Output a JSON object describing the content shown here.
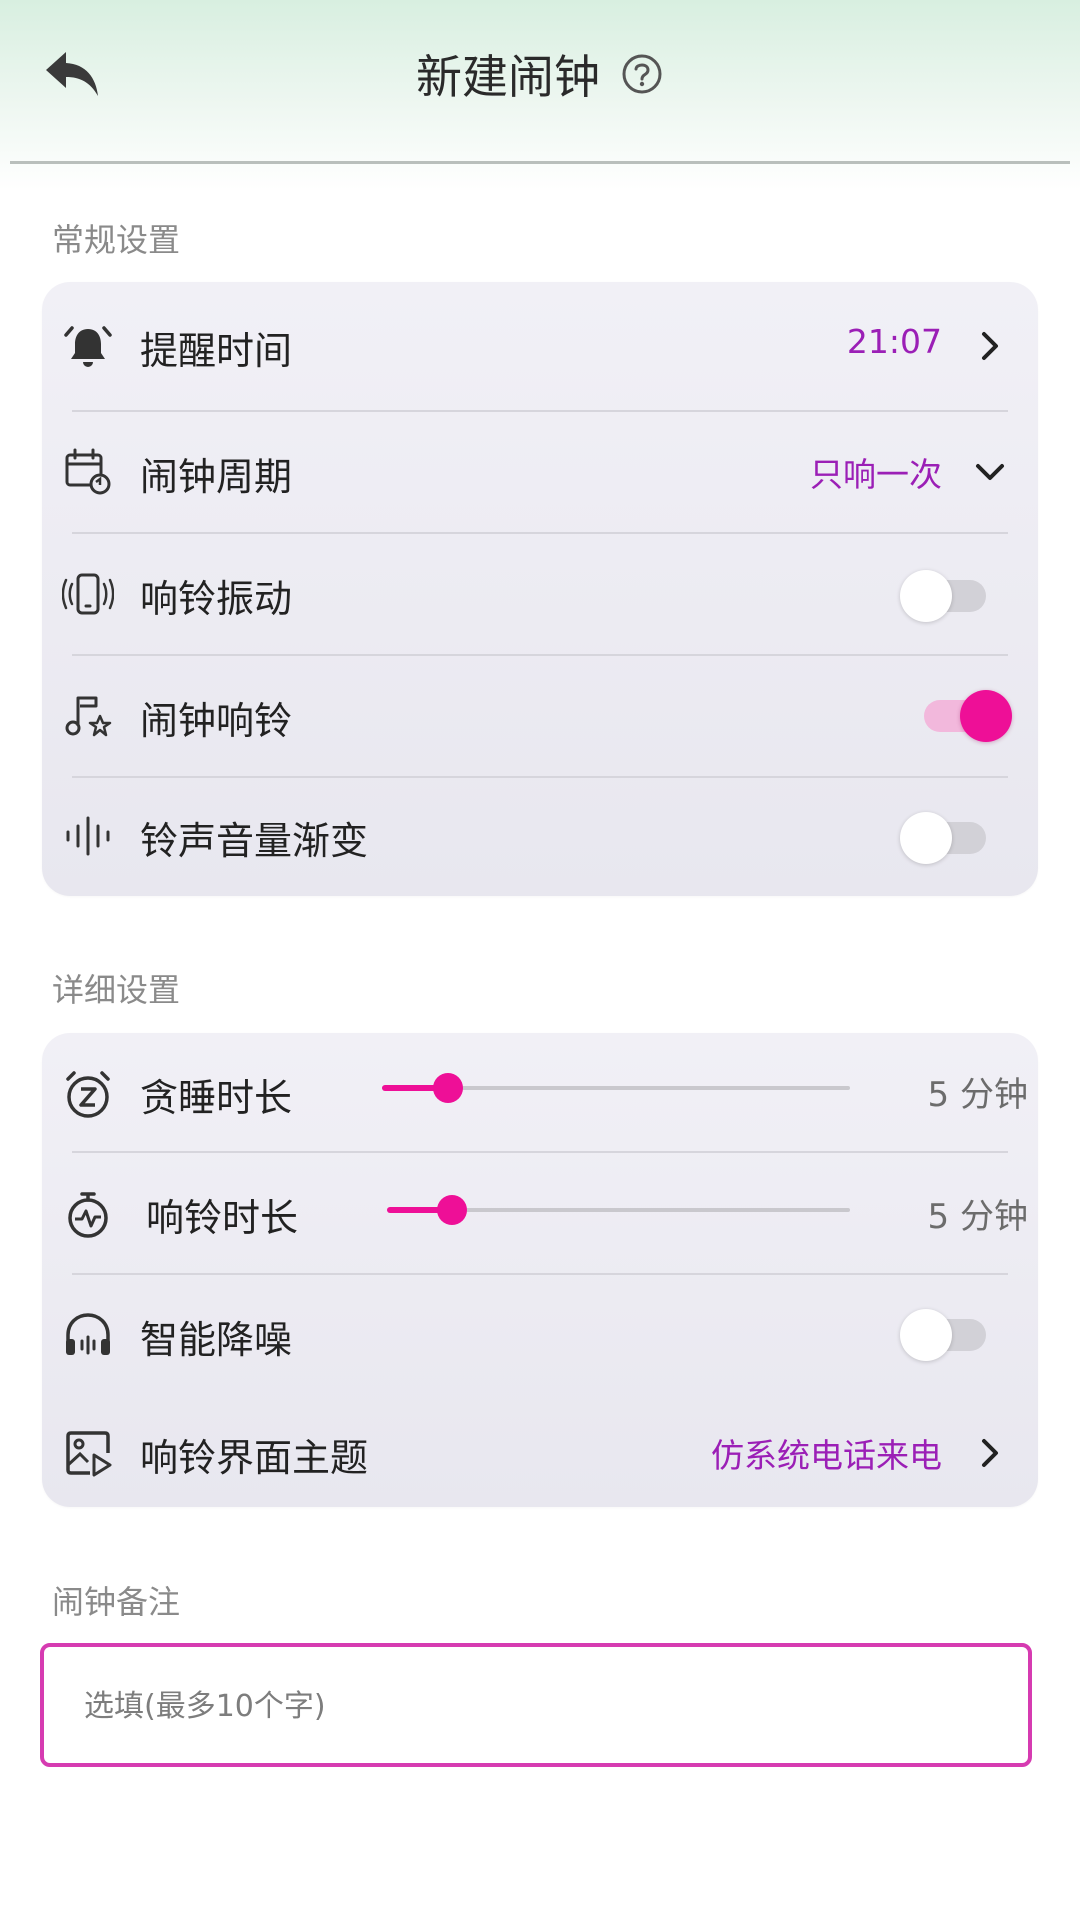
{
  "header": {
    "title": "新建闹钟",
    "back_icon": "back-arrow-icon",
    "help_icon": "help-circle-icon"
  },
  "sections": {
    "general": "常规设置",
    "detail": "详细设置",
    "note": "闹钟备注"
  },
  "general": {
    "remind_time": {
      "label": "提醒时间",
      "value": "21:07",
      "icon": "bell-icon"
    },
    "period": {
      "label": "闹钟周期",
      "value": "只响一次",
      "icon": "calendar-repeat-icon"
    },
    "vibrate": {
      "label": "响铃振动",
      "on": false,
      "icon": "phone-vibrate-icon"
    },
    "ring": {
      "label": "闹钟响铃",
      "on": true,
      "icon": "music-note-icon"
    },
    "fade_in": {
      "label": "铃声音量渐变",
      "on": false,
      "icon": "sound-wave-icon"
    }
  },
  "detail": {
    "snooze": {
      "label": "贪睡时长",
      "value": "5 分钟",
      "level": 0.14,
      "icon": "snooze-alarm-icon"
    },
    "ring_duration": {
      "label": "响铃时长",
      "value": "5 分钟",
      "level": 0.14,
      "icon": "stopwatch-icon"
    },
    "noise_reduction": {
      "label": "智能降噪",
      "on": false,
      "icon": "headphones-icon"
    },
    "theme": {
      "label": "响铃界面主题",
      "value": "仿系统电话来电",
      "icon": "image-play-icon"
    }
  },
  "note": {
    "placeholder": "选填(最多10个字)",
    "value": ""
  },
  "colors": {
    "accent": "#ee0f97",
    "value_text": "#9b1fb6",
    "input_border": "#d63bb1"
  }
}
